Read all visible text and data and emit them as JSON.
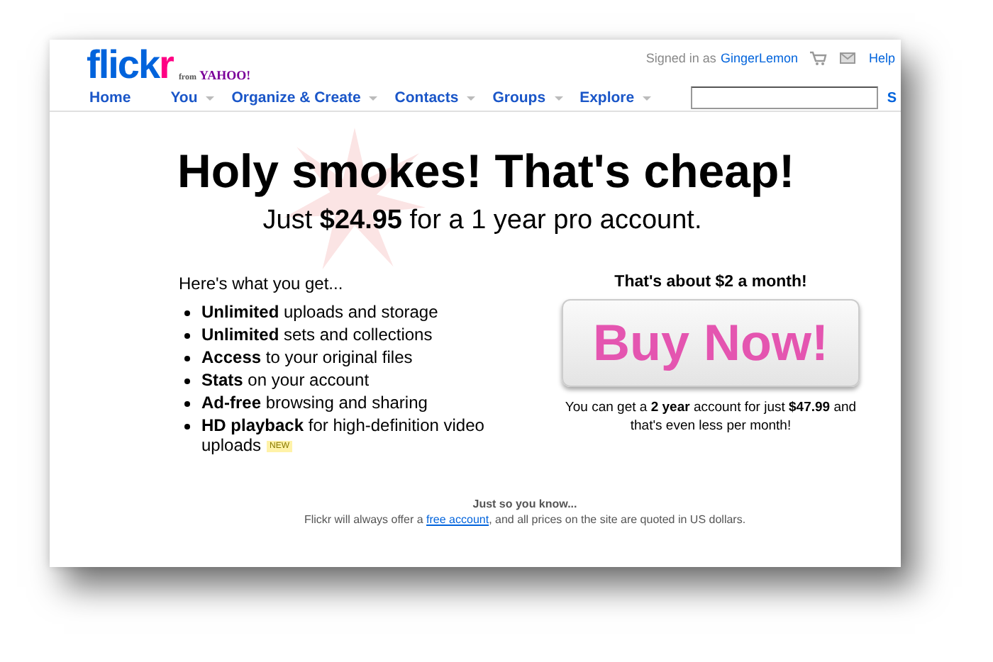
{
  "logo": {
    "parts": [
      {
        "text": "flick",
        "color": "#0063dc"
      },
      {
        "text": "r",
        "color": "#ff0084"
      }
    ],
    "from": "from",
    "yahoo": "YAHOO!"
  },
  "header": {
    "signed_in_label": "Signed in as",
    "username": "GingerLemon",
    "help": "Help"
  },
  "nav": [
    {
      "label": "Home",
      "has_menu": false
    },
    {
      "label": "You",
      "has_menu": true
    },
    {
      "label": "Organize & Create",
      "has_menu": true
    },
    {
      "label": "Contacts",
      "has_menu": true
    },
    {
      "label": "Groups",
      "has_menu": true
    },
    {
      "label": "Explore",
      "has_menu": true
    }
  ],
  "search": {
    "button": "S"
  },
  "headline": "Holy smokes! That's cheap!",
  "subheadline": "Just **$24.95** for a 1 year pro account.",
  "benefits": {
    "intro": "Here's what you get...",
    "items": [
      {
        "text": "**Unlimited** uploads and storage",
        "is_new": false
      },
      {
        "text": "**Unlimited** sets and collections",
        "is_new": false
      },
      {
        "text": "**Access** to your original files",
        "is_new": false
      },
      {
        "text": "**Stats** on your account",
        "is_new": false
      },
      {
        "text": "**Ad-free** browsing and sharing",
        "is_new": false
      },
      {
        "text": "**HD playback** for high-definition video uploads",
        "is_new": true
      }
    ],
    "new_badge": "NEW"
  },
  "offer": {
    "monthly": "That's about $2 a month!",
    "button": "Buy Now!",
    "note": "You can get a **2 year** account for just **$47.99** and that's even less per month!"
  },
  "footer": {
    "title": "Just so you know...",
    "before": "Flickr will always offer a ",
    "link": "free account",
    "after": ", and all prices on the site are quoted in US dollars."
  }
}
